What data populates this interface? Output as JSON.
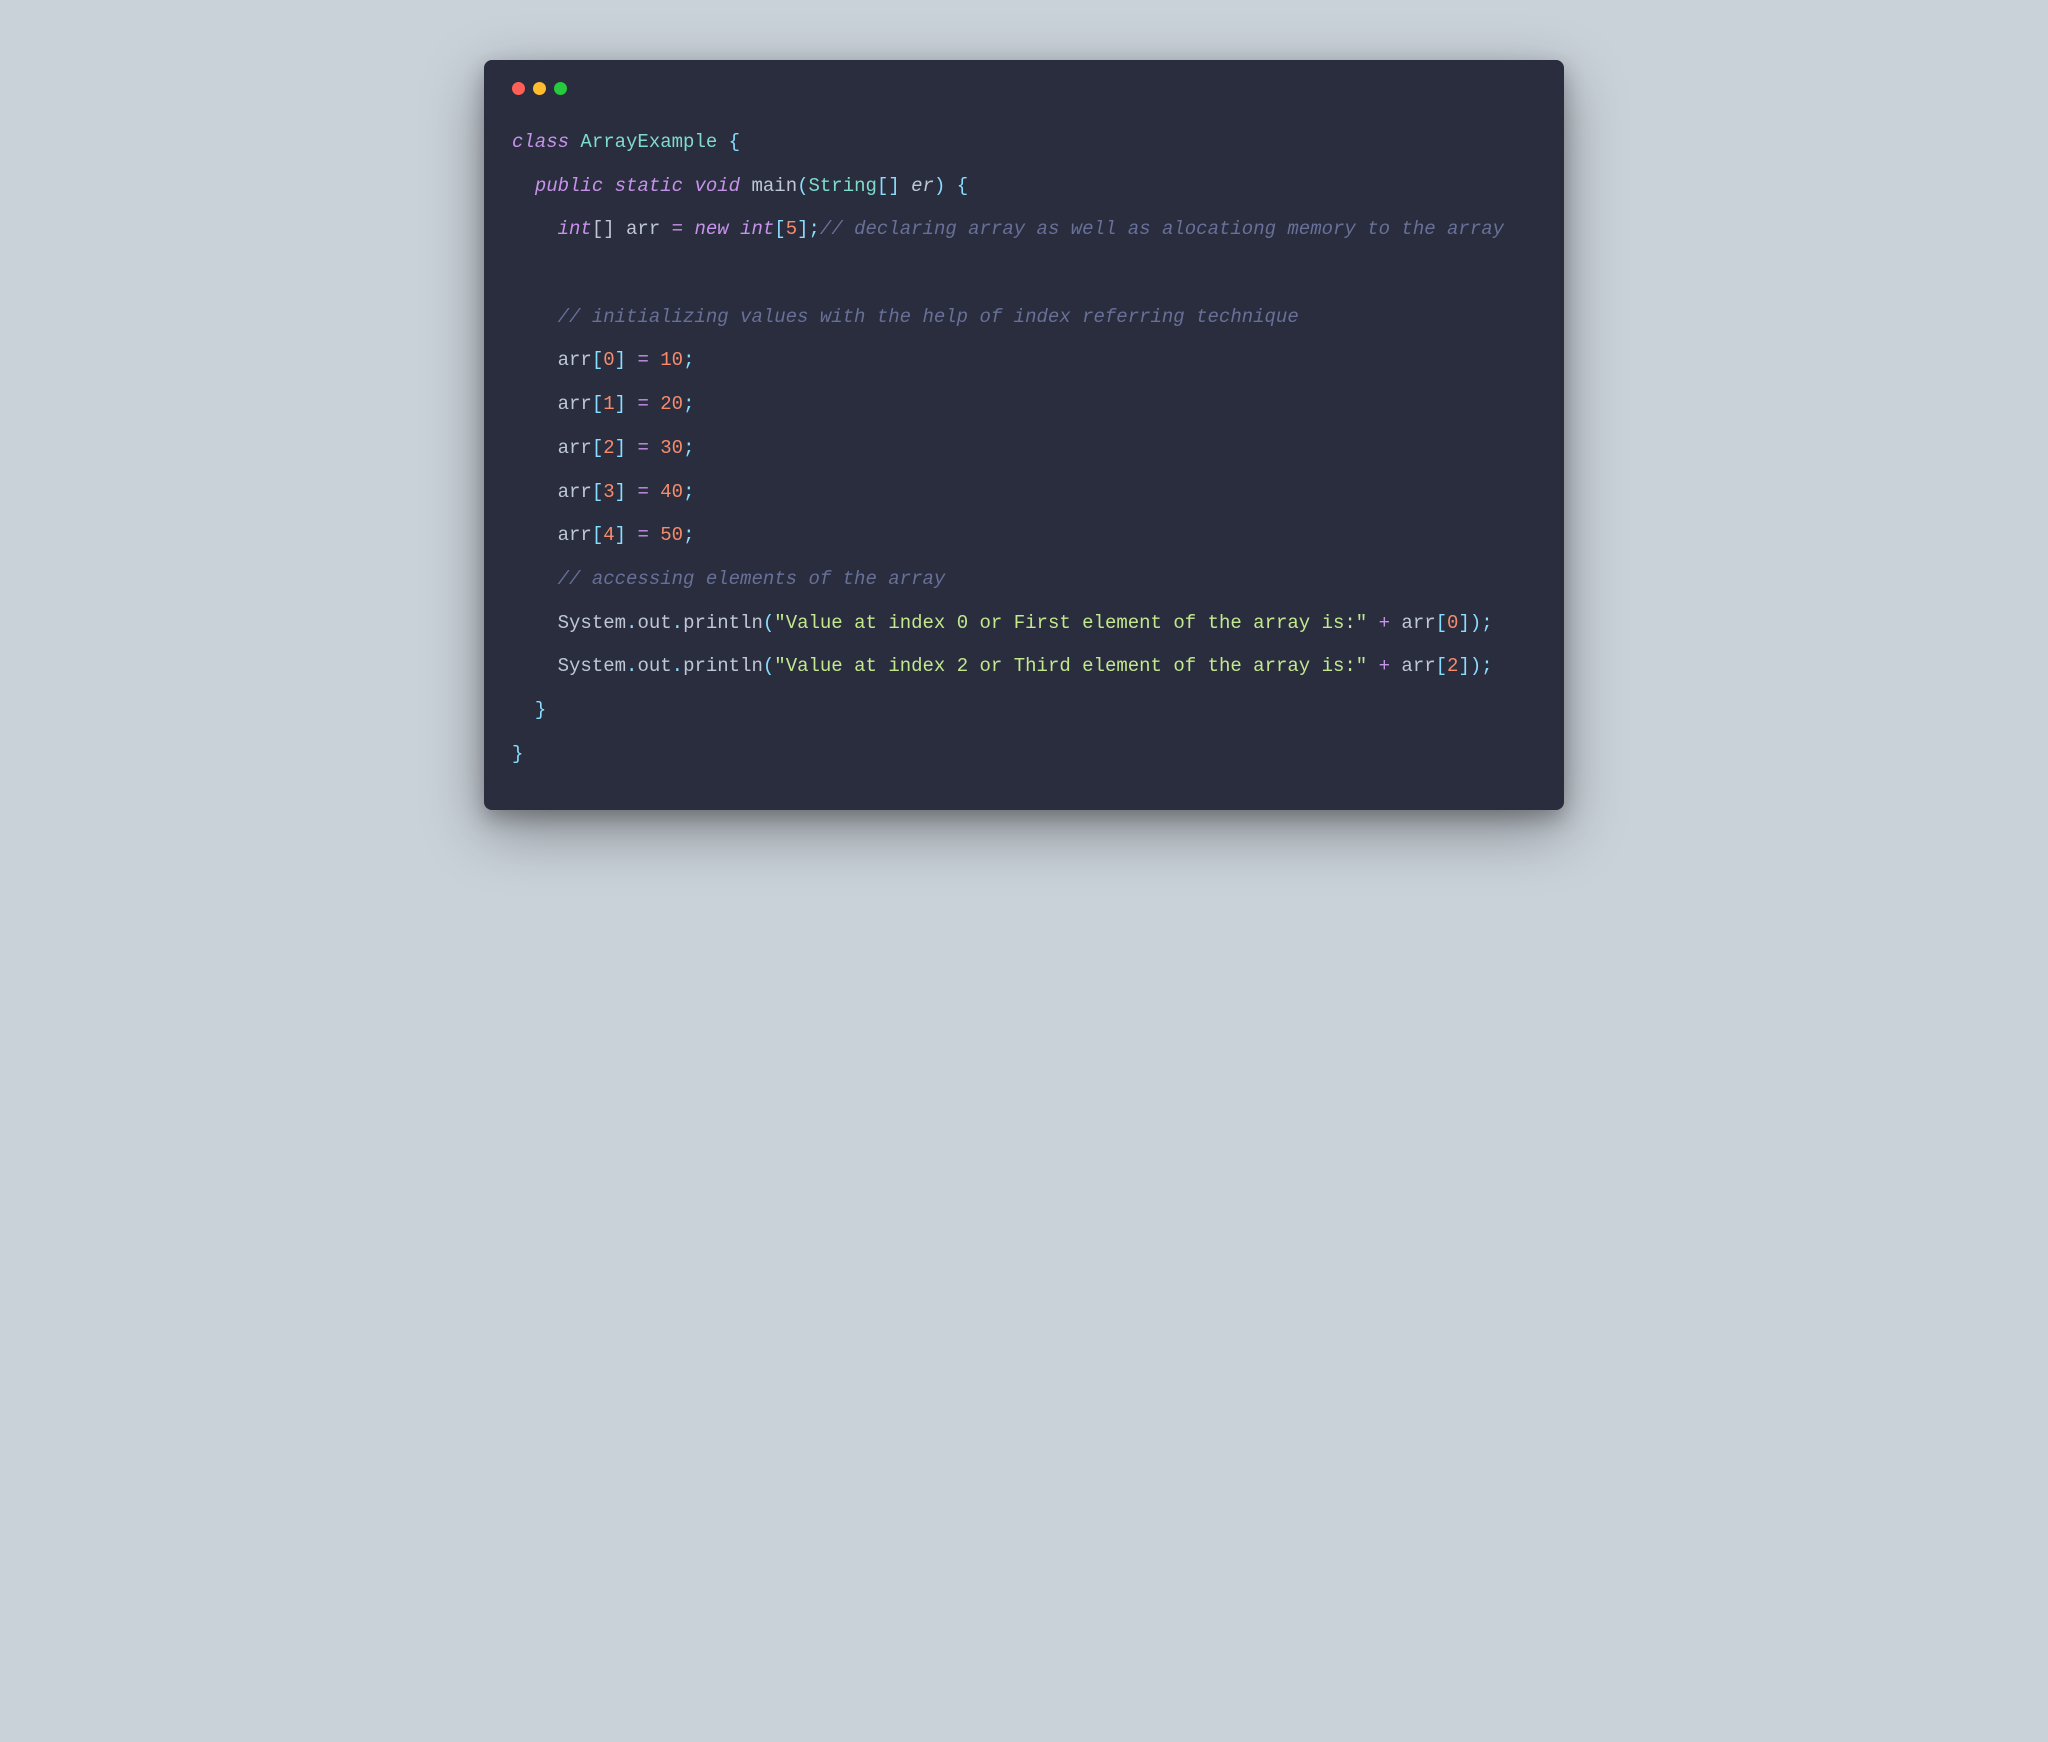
{
  "colors": {
    "bg": "#292d3e",
    "fg": "#bfc7d5",
    "keyword": "#c792ea",
    "classname": "#89ddff",
    "classnameGreen": "#7fdbca",
    "func": "#ffcb6b",
    "punct": "#89ddff",
    "number": "#f78c6c",
    "string": "#c3e88d",
    "comment": "#697098"
  },
  "tokens": {
    "class_kw": "class",
    "class_name": "ArrayExample",
    "lbrace1": " {",
    "public_kw": "public",
    "static_kw": "static",
    "void_kw": "void",
    "main_fn": "main",
    "lparen": "(",
    "string_type": "String",
    "brackets_empty": "[]",
    "param_name": " er",
    "rparen": ")",
    "lbrace2": " {",
    "int_kw": "int",
    "arr_decl": "[] arr ",
    "equals": "=",
    "new_kw": " new ",
    "int_kw2": "int",
    "lbracket": "[",
    "five": "5",
    "rbracket_semi": "];",
    "comment1": "// declaring array as well as alocationg memory to the array",
    "comment2": "// initializing values with the help of index referring technique",
    "arr": "arr",
    "lb": "[",
    "idx0": "0",
    "idx1": "1",
    "idx2": "2",
    "idx3": "3",
    "idx4": "4",
    "rb_eq": "] ",
    "eq": "=",
    "val10": " 10",
    "val20": " 20",
    "val30": " 30",
    "val40": " 40",
    "val50": " 50",
    "semi": ";",
    "comment3": "// accessing elements of the array",
    "system": "System",
    "dot": ".",
    "out": "out",
    "println": "println",
    "str1": "\"Value at index 0 or First element of the array is:\"",
    "str2": "\"Value at index 2 or Third element of the array is:\"",
    "plus": " + ",
    "arr_ref": "arr",
    "rb": "]",
    "rparen_semi": ");",
    "rbrace": "}",
    "sp2": "  ",
    "sp4": "    ",
    "sp": " "
  }
}
